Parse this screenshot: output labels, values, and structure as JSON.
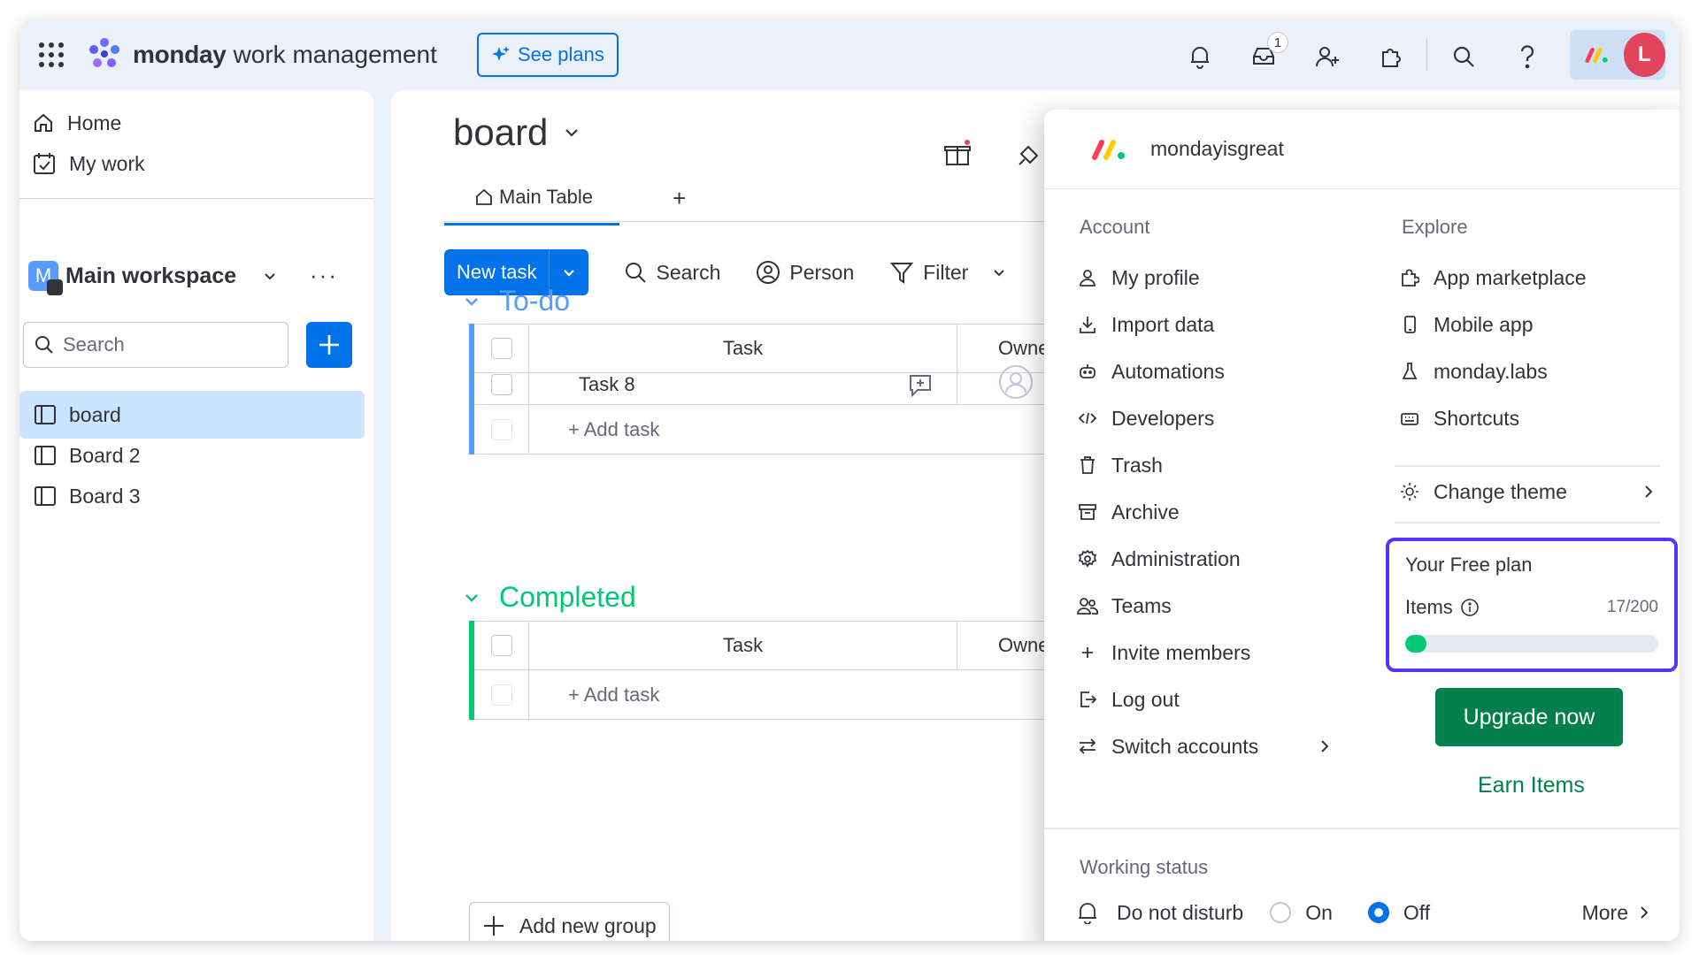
{
  "brand": {
    "name": "monday",
    "product": "work management"
  },
  "topbar": {
    "see_plans": "See plans",
    "inbox_badge": "1",
    "avatar_letter": "L"
  },
  "sidebar": {
    "home": "Home",
    "my_work": "My work",
    "workspace_icon_letter": "M",
    "workspace_name": "Main workspace",
    "more": "···",
    "search_placeholder": "Search",
    "boards": [
      "board",
      "Board 2",
      "Board 3"
    ],
    "active_board": "board"
  },
  "board": {
    "title": "board",
    "tabs": {
      "main_table": "Main Table",
      "add": "+"
    },
    "toolbar": {
      "new_task": "New task",
      "search": "Search",
      "person": "Person",
      "filter": "Filter"
    },
    "groups": [
      {
        "name": "To-do",
        "color": "#579bfc",
        "columns": {
          "task": "Task",
          "owner": "Owne"
        },
        "rows": [
          "Task 8"
        ],
        "add_task": "+ Add task"
      },
      {
        "name": "Completed",
        "color": "#00c875",
        "columns": {
          "task": "Task",
          "owner": "Owne"
        },
        "rows": [],
        "add_task": "+ Add task"
      }
    ],
    "add_group": "Add new group"
  },
  "menu": {
    "account_name": "mondayisgreat",
    "account_title": "Account",
    "account_items": [
      {
        "label": "My profile",
        "icon": "person-icon"
      },
      {
        "label": "Import data",
        "icon": "download-icon"
      },
      {
        "label": "Automations",
        "icon": "robot-icon"
      },
      {
        "label": "Developers",
        "icon": "code-icon"
      },
      {
        "label": "Trash",
        "icon": "trash-icon"
      },
      {
        "label": "Archive",
        "icon": "archive-icon"
      },
      {
        "label": "Administration",
        "icon": "gear-icon"
      },
      {
        "label": "Teams",
        "icon": "team-icon"
      },
      {
        "label": "Invite members",
        "icon": "plus-icon"
      },
      {
        "label": "Log out",
        "icon": "logout-icon"
      },
      {
        "label": "Switch accounts",
        "icon": "switch-icon"
      }
    ],
    "explore_title": "Explore",
    "explore_items": [
      {
        "label": "App marketplace",
        "icon": "puzzle-icon"
      },
      {
        "label": "Mobile app",
        "icon": "mobile-icon"
      },
      {
        "label": "monday.labs",
        "icon": "flask-icon"
      },
      {
        "label": "Shortcuts",
        "icon": "keyboard-icon"
      }
    ],
    "change_theme": "Change theme",
    "plan": {
      "title": "Your Free plan",
      "items_label": "Items",
      "count": "17/200",
      "used": 17,
      "limit": 200
    },
    "upgrade": "Upgrade now",
    "earn": "Earn Items",
    "working_status": "Working status",
    "dnd": "Do not disturb",
    "on": "On",
    "off": "Off",
    "selected": "Off",
    "more": "More"
  },
  "colors": {
    "primary": "#0073ea",
    "upgrade_green": "#037f4c",
    "progress": "#00c875",
    "plan_border": "#5034ff",
    "completed": "#00c875"
  }
}
